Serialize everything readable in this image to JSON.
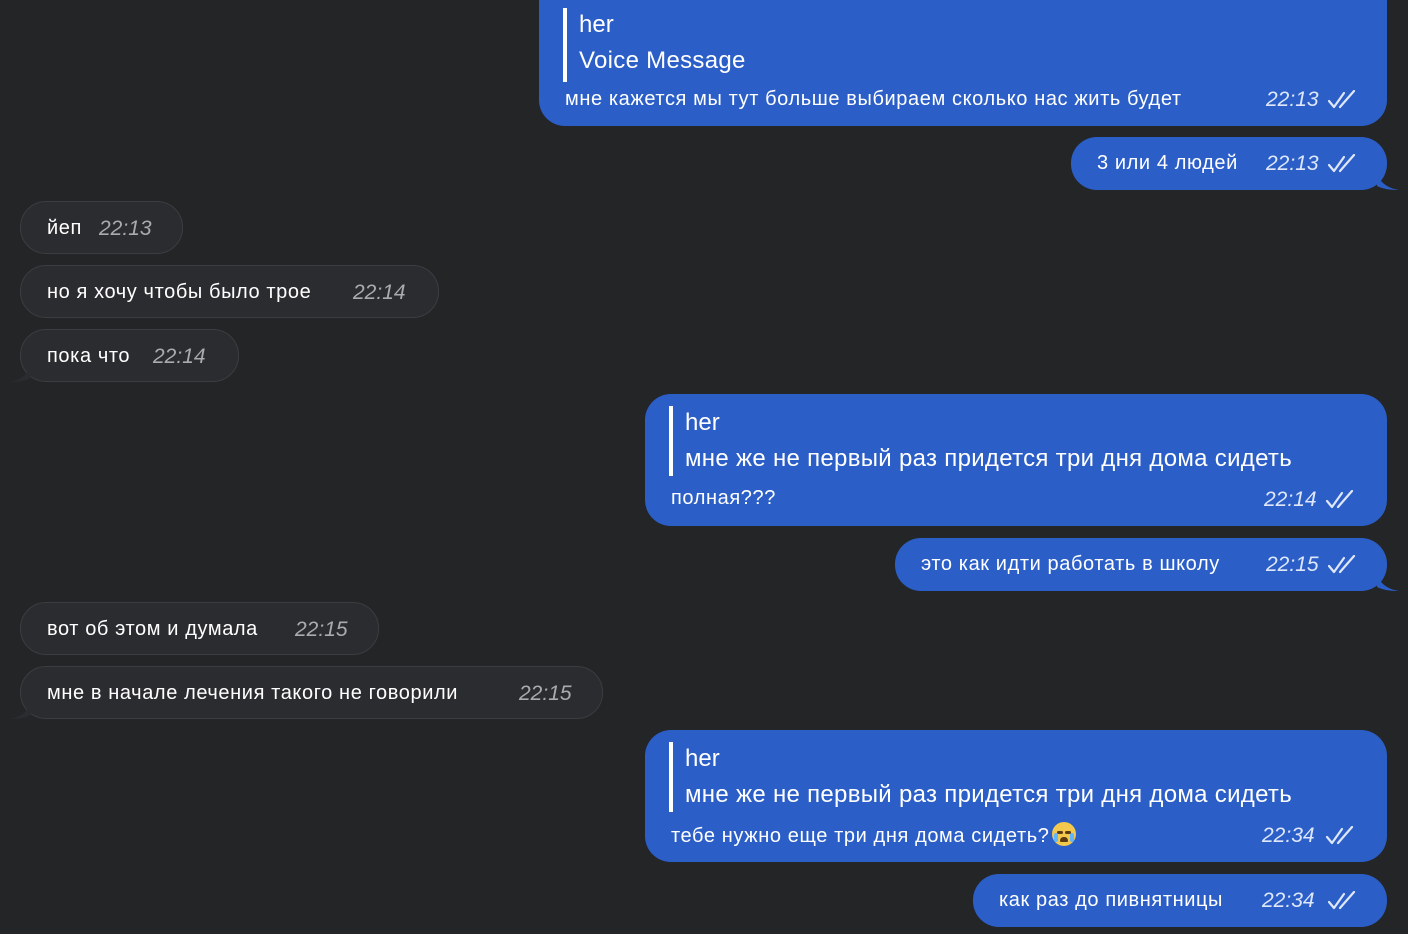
{
  "messages": [
    {
      "direction": "out",
      "reply_to": {
        "author": "her",
        "text": "Voice Message"
      },
      "text": "мне кажется мы тут больше выбираем сколько нас жить будет",
      "time": "22:13",
      "status": "read-double-check-icon"
    },
    {
      "direction": "out",
      "text": "3 или 4 людей",
      "time": "22:13",
      "status": "read-double-check-icon"
    },
    {
      "direction": "in",
      "text": "йеп",
      "time": "22:13"
    },
    {
      "direction": "in",
      "text": "но я хочу чтобы было трое",
      "time": "22:14"
    },
    {
      "direction": "in",
      "text": "пока что",
      "time": "22:14"
    },
    {
      "direction": "out",
      "reply_to": {
        "author": "her",
        "text": "мне же не первый раз придется три дня дома сидеть"
      },
      "text": "полная???",
      "time": "22:14",
      "status": "read-double-check-icon"
    },
    {
      "direction": "out",
      "text": "это как идти работать в школу",
      "time": "22:15",
      "status": "read-double-check-icon"
    },
    {
      "direction": "in",
      "text": "вот об этом и думала",
      "time": "22:15"
    },
    {
      "direction": "in",
      "text": "мне в начале лечения такого не говорили",
      "time": "22:15"
    },
    {
      "direction": "out",
      "reply_to": {
        "author": "her",
        "text": "мне же не первый раз придется три дня дома сидеть"
      },
      "text": "тебе нужно еще три дня дома сидеть?",
      "emoji": "crying-face-emoji",
      "time": "22:34",
      "status": "read-double-check-icon"
    },
    {
      "direction": "out",
      "text": "как раз до пивнятницы",
      "time": "22:34",
      "status": "read-double-check-icon"
    }
  ],
  "colors": {
    "background": "#232527",
    "outgoing_bubble": "#2b5fc7",
    "incoming_bubble": "#2a2c2f"
  }
}
